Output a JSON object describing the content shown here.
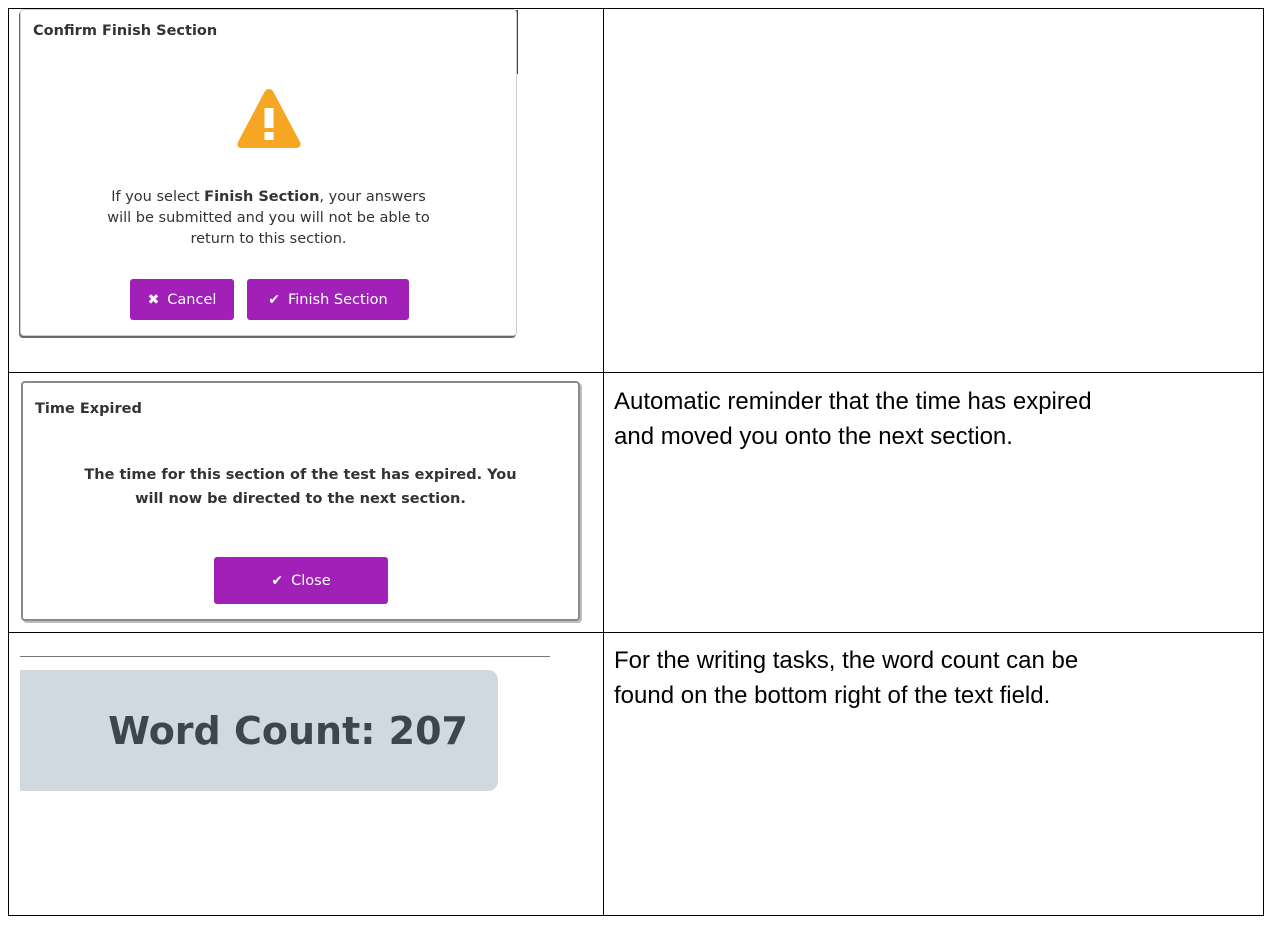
{
  "rows": [
    {
      "dialog": {
        "title": "Confirm Finish Section",
        "message_prefix": "If you select ",
        "message_bold": "Finish Section",
        "message_line1_suffix": ", your answers",
        "message_line2": "will be submitted and you will not be able to",
        "message_line3": "return to this section.",
        "buttons": {
          "cancel": "Cancel",
          "finish": "Finish Section"
        },
        "icon": "warning-triangle-icon",
        "accent_color": "#a020b8",
        "icon_color": "#f5a623"
      },
      "description": ""
    },
    {
      "dialog": {
        "title": "Time Expired",
        "message_line1": "The time for this section of the test has expired. You",
        "message_line2": "will now be directed to the next section.",
        "buttons": {
          "close": "Close"
        },
        "accent_color": "#a020b8"
      },
      "description_line1": "Automatic reminder that the time has expired",
      "description_line2": "and moved you onto the next section."
    },
    {
      "word_count": {
        "label": "Word Count: 207",
        "background": "#d1d9e0"
      },
      "description_line1": "For the writing tasks, the word count can be",
      "description_line2": "found on the bottom right of the text field."
    }
  ]
}
